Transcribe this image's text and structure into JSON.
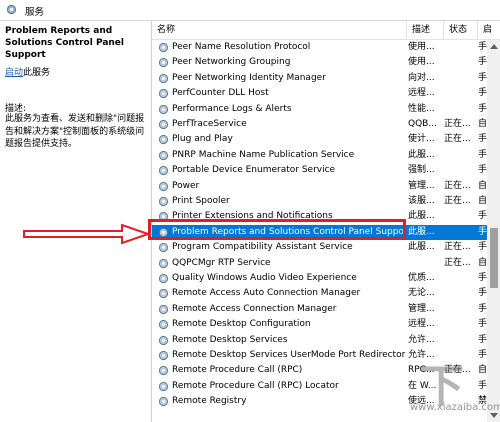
{
  "window": {
    "title": "服务",
    "icon": "gear-icon"
  },
  "left_pane": {
    "service_title": "Problem Reports and Solutions Control Panel Support",
    "start_link": "启动",
    "start_suffix": "此服务",
    "desc_label": "描述:",
    "desc_text": "此服务为查看、发送和删除\"问题报告和解决方案\"控制面板的系统级问题报告提供支持。"
  },
  "list": {
    "headers": {
      "name": "名称",
      "desc": "描述",
      "status": "状态",
      "start": "启"
    },
    "rows": [
      {
        "name": "Peer Name Resolution Protocol",
        "desc": "使用...",
        "status": "",
        "start": "手"
      },
      {
        "name": "Peer Networking Grouping",
        "desc": "使用...",
        "status": "",
        "start": "手"
      },
      {
        "name": "Peer Networking Identity Manager",
        "desc": "向对...",
        "status": "",
        "start": "手"
      },
      {
        "name": "PerfCounter DLL Host",
        "desc": "远程...",
        "status": "",
        "start": "手"
      },
      {
        "name": "Performance Logs & Alerts",
        "desc": "性能...",
        "status": "",
        "start": "手"
      },
      {
        "name": "PerfTraceService",
        "desc": "QQB...",
        "status": "正在...",
        "start": "自"
      },
      {
        "name": "Plug and Play",
        "desc": "使计...",
        "status": "正在...",
        "start": "手"
      },
      {
        "name": "PNRP Machine Name Publication Service",
        "desc": "此服...",
        "status": "",
        "start": "手"
      },
      {
        "name": "Portable Device Enumerator Service",
        "desc": "强制...",
        "status": "",
        "start": "手"
      },
      {
        "name": "Power",
        "desc": "管理...",
        "status": "正在...",
        "start": "自"
      },
      {
        "name": "Print Spooler",
        "desc": "该服...",
        "status": "正在...",
        "start": "自"
      },
      {
        "name": "Printer Extensions and Notifications",
        "desc": "此服...",
        "status": "",
        "start": "手"
      },
      {
        "name": "Problem Reports and Solutions Control Panel Support",
        "desc": "此服...",
        "status": "",
        "start": "手",
        "selected": true
      },
      {
        "name": "Program Compatibility Assistant Service",
        "desc": "此服...",
        "status": "正在...",
        "start": "手"
      },
      {
        "name": "QQPCMgr RTP Service",
        "desc": "",
        "status": "正在...",
        "start": "自"
      },
      {
        "name": "Quality Windows Audio Video Experience",
        "desc": "优质...",
        "status": "",
        "start": "手"
      },
      {
        "name": "Remote Access Auto Connection Manager",
        "desc": "无论...",
        "status": "",
        "start": "手"
      },
      {
        "name": "Remote Access Connection Manager",
        "desc": "管理...",
        "status": "",
        "start": "手"
      },
      {
        "name": "Remote Desktop Configuration",
        "desc": "远程...",
        "status": "",
        "start": "手"
      },
      {
        "name": "Remote Desktop Services",
        "desc": "允许...",
        "status": "",
        "start": "手"
      },
      {
        "name": "Remote Desktop Services UserMode Port Redirector",
        "desc": "允许...",
        "status": "",
        "start": "手"
      },
      {
        "name": "Remote Procedure Call (RPC)",
        "desc": "RPC...",
        "status": "正在...",
        "start": "自"
      },
      {
        "name": "Remote Procedure Call (RPC) Locator",
        "desc": "在 W...",
        "status": "",
        "start": "手"
      },
      {
        "name": "Remote Registry",
        "desc": "使远...",
        "status": "",
        "start": "禁"
      }
    ]
  },
  "watermark": {
    "url": "www.xiazaiba.com"
  },
  "colors": {
    "selection": "#0078d7",
    "highlight": "#e02020",
    "link": "#1a5fb4"
  }
}
